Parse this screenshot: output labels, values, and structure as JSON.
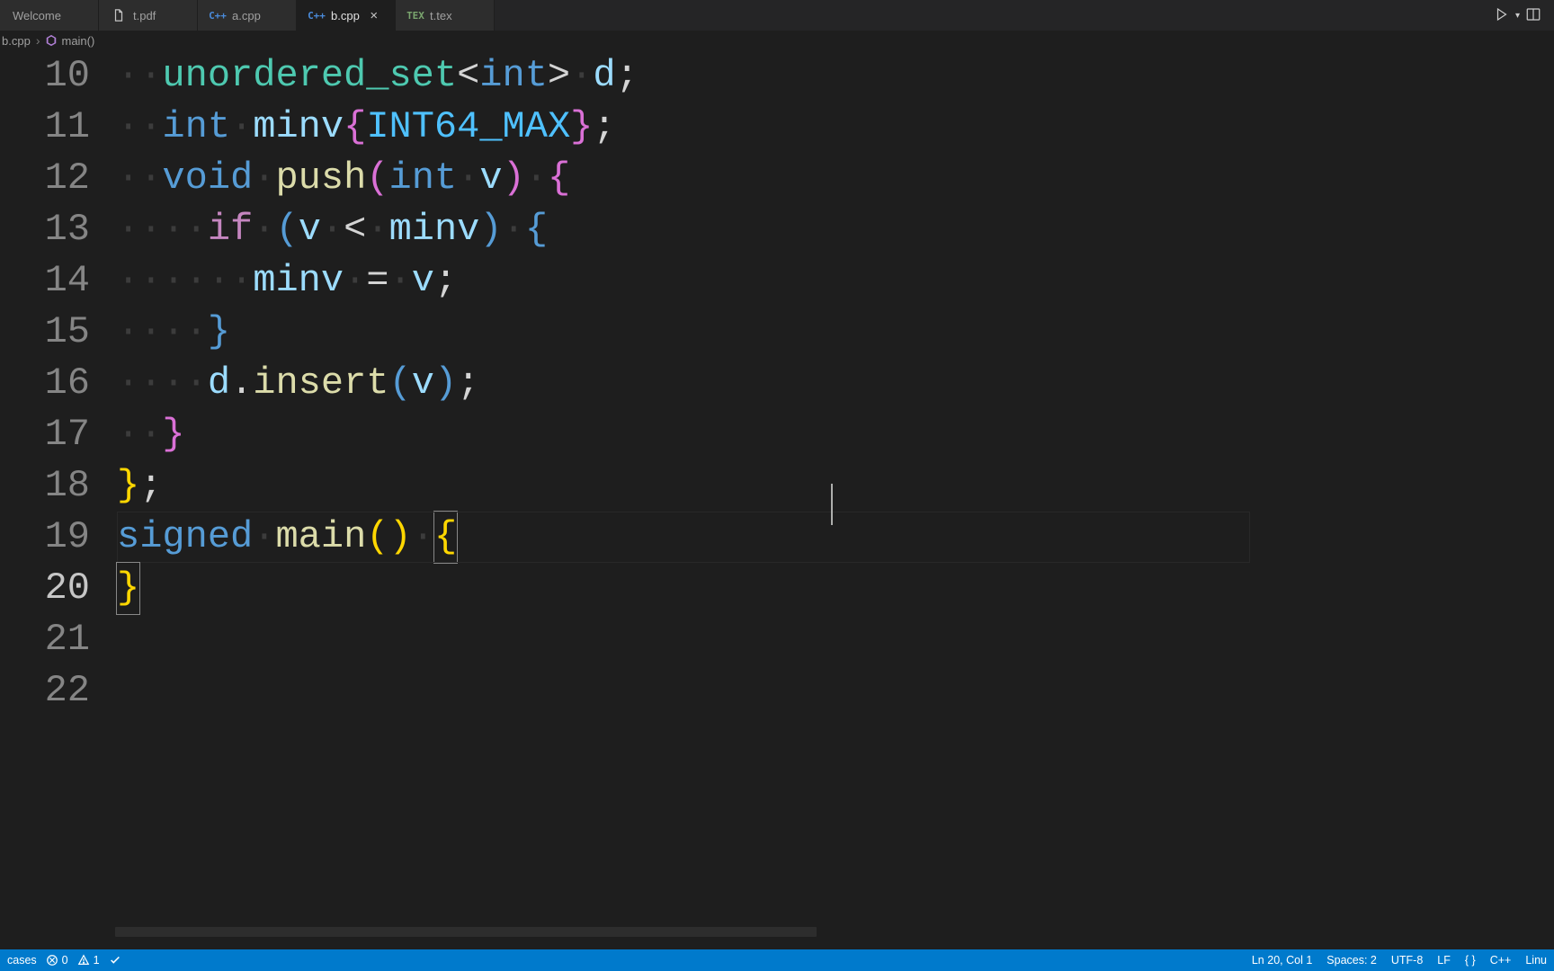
{
  "tabs": {
    "list": [
      {
        "label": "Welcome",
        "kind": "welcome"
      },
      {
        "label": "t.pdf",
        "kind": "file"
      },
      {
        "label": "a.cpp",
        "kind": "cpp"
      },
      {
        "label": "b.cpp",
        "kind": "cpp",
        "active": true
      },
      {
        "label": "t.tex",
        "kind": "tex"
      }
    ]
  },
  "breadcrumb": {
    "file": "b.cpp",
    "symbol": "main()"
  },
  "editor": {
    "first_line_number": 10,
    "cursor_line": 20,
    "lines": [
      {
        "tokens": [
          [
            "ws",
            "··"
          ],
          [
            "tk-type",
            "unordered_set"
          ],
          [
            "tk-punct",
            "<"
          ],
          [
            "tk-keyword",
            "int"
          ],
          [
            "tk-punct",
            ">"
          ],
          [
            "ws",
            "·"
          ],
          [
            "tk-var",
            "d"
          ],
          [
            "tk-punct",
            ";"
          ]
        ]
      },
      {
        "tokens": [
          [
            "ws",
            "··"
          ],
          [
            "tk-keyword",
            "int"
          ],
          [
            "ws",
            "·"
          ],
          [
            "tk-var",
            "minv"
          ],
          [
            "tk-brace2",
            "{"
          ],
          [
            "tk-const",
            "INT64_MAX"
          ],
          [
            "tk-brace2",
            "}"
          ],
          [
            "tk-punct",
            ";"
          ]
        ]
      },
      {
        "tokens": [
          [
            "ws",
            "··"
          ],
          [
            "tk-keyword",
            "void"
          ],
          [
            "ws",
            "·"
          ],
          [
            "tk-func",
            "push"
          ],
          [
            "tk-brace2",
            "("
          ],
          [
            "tk-keyword",
            "int"
          ],
          [
            "ws",
            "·"
          ],
          [
            "tk-var",
            "v"
          ],
          [
            "tk-brace2",
            ")"
          ],
          [
            "ws",
            "·"
          ],
          [
            "tk-brace2",
            "{"
          ]
        ]
      },
      {
        "tokens": [
          [
            "ws",
            "····"
          ],
          [
            "tk-ctrl",
            "if"
          ],
          [
            "ws",
            "·"
          ],
          [
            "tk-brace3",
            "("
          ],
          [
            "tk-var",
            "v"
          ],
          [
            "ws",
            "·"
          ],
          [
            "tk-punct",
            "<"
          ],
          [
            "ws",
            "·"
          ],
          [
            "tk-var",
            "minv"
          ],
          [
            "tk-brace3",
            ")"
          ],
          [
            "ws",
            "·"
          ],
          [
            "tk-brace3",
            "{"
          ]
        ]
      },
      {
        "tokens": [
          [
            "ws",
            "······"
          ],
          [
            "tk-var",
            "minv"
          ],
          [
            "ws",
            "·"
          ],
          [
            "tk-punct",
            "="
          ],
          [
            "ws",
            "·"
          ],
          [
            "tk-var",
            "v"
          ],
          [
            "tk-punct",
            ";"
          ]
        ]
      },
      {
        "tokens": [
          [
            "ws",
            "····"
          ],
          [
            "tk-brace3",
            "}"
          ]
        ]
      },
      {
        "tokens": [
          [
            "ws",
            "····"
          ],
          [
            "tk-var",
            "d"
          ],
          [
            "tk-punct",
            "."
          ],
          [
            "tk-call",
            "insert"
          ],
          [
            "tk-brace3",
            "("
          ],
          [
            "tk-var",
            "v"
          ],
          [
            "tk-brace3",
            ")"
          ],
          [
            "tk-punct",
            ";"
          ]
        ]
      },
      {
        "tokens": [
          [
            "ws",
            "··"
          ],
          [
            "tk-brace2",
            "}"
          ]
        ]
      },
      {
        "tokens": [
          [
            "tk-brace",
            "}"
          ],
          [
            "tk-punct",
            ";"
          ]
        ]
      },
      {
        "tokens": []
      },
      {
        "tokens": [
          [
            "tk-keyword",
            "signed"
          ],
          [
            "ws",
            "·"
          ],
          [
            "tk-func",
            "main"
          ],
          [
            "tk-brace",
            "("
          ],
          [
            "tk-brace",
            ")"
          ],
          [
            "ws",
            "·"
          ],
          [
            "tk-brace",
            "{",
            "box"
          ]
        ]
      },
      {
        "tokens": [
          [
            "tk-brace",
            "}",
            "box"
          ]
        ]
      },
      {
        "tokens": []
      }
    ]
  },
  "statusbar": {
    "left": {
      "cases": "cases",
      "errors": "0",
      "warnings": "1"
    },
    "right": {
      "position": "Ln 20, Col 1",
      "spaces": "Spaces: 2",
      "encoding": "UTF-8",
      "eol": "LF",
      "lang_icon": "{ }",
      "lang": "C++",
      "os": "Linu"
    }
  }
}
